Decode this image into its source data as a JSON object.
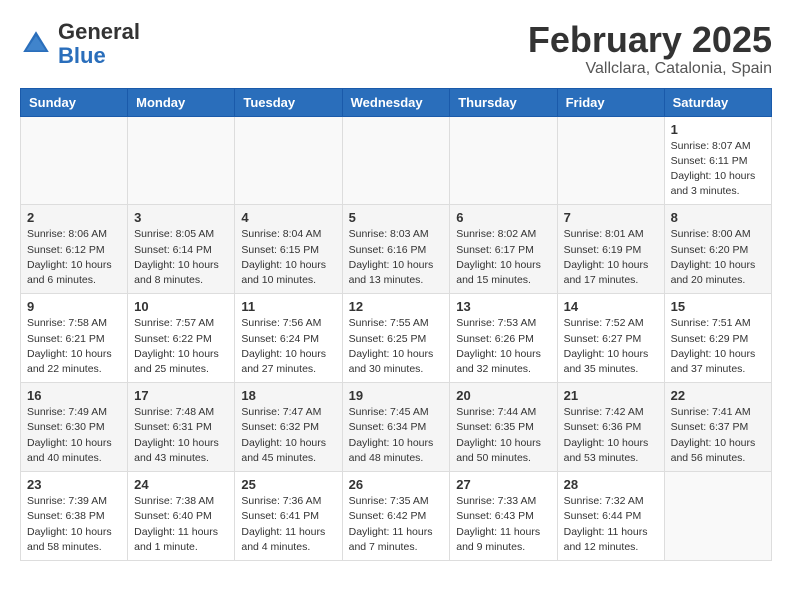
{
  "logo": {
    "general": "General",
    "blue": "Blue"
  },
  "title": "February 2025",
  "location": "Vallclara, Catalonia, Spain",
  "days_of_week": [
    "Sunday",
    "Monday",
    "Tuesday",
    "Wednesday",
    "Thursday",
    "Friday",
    "Saturday"
  ],
  "weeks": [
    [
      {
        "day": "",
        "info": ""
      },
      {
        "day": "",
        "info": ""
      },
      {
        "day": "",
        "info": ""
      },
      {
        "day": "",
        "info": ""
      },
      {
        "day": "",
        "info": ""
      },
      {
        "day": "",
        "info": ""
      },
      {
        "day": "1",
        "info": "Sunrise: 8:07 AM\nSunset: 6:11 PM\nDaylight: 10 hours and 3 minutes."
      }
    ],
    [
      {
        "day": "2",
        "info": "Sunrise: 8:06 AM\nSunset: 6:12 PM\nDaylight: 10 hours and 6 minutes."
      },
      {
        "day": "3",
        "info": "Sunrise: 8:05 AM\nSunset: 6:14 PM\nDaylight: 10 hours and 8 minutes."
      },
      {
        "day": "4",
        "info": "Sunrise: 8:04 AM\nSunset: 6:15 PM\nDaylight: 10 hours and 10 minutes."
      },
      {
        "day": "5",
        "info": "Sunrise: 8:03 AM\nSunset: 6:16 PM\nDaylight: 10 hours and 13 minutes."
      },
      {
        "day": "6",
        "info": "Sunrise: 8:02 AM\nSunset: 6:17 PM\nDaylight: 10 hours and 15 minutes."
      },
      {
        "day": "7",
        "info": "Sunrise: 8:01 AM\nSunset: 6:19 PM\nDaylight: 10 hours and 17 minutes."
      },
      {
        "day": "8",
        "info": "Sunrise: 8:00 AM\nSunset: 6:20 PM\nDaylight: 10 hours and 20 minutes."
      }
    ],
    [
      {
        "day": "9",
        "info": "Sunrise: 7:58 AM\nSunset: 6:21 PM\nDaylight: 10 hours and 22 minutes."
      },
      {
        "day": "10",
        "info": "Sunrise: 7:57 AM\nSunset: 6:22 PM\nDaylight: 10 hours and 25 minutes."
      },
      {
        "day": "11",
        "info": "Sunrise: 7:56 AM\nSunset: 6:24 PM\nDaylight: 10 hours and 27 minutes."
      },
      {
        "day": "12",
        "info": "Sunrise: 7:55 AM\nSunset: 6:25 PM\nDaylight: 10 hours and 30 minutes."
      },
      {
        "day": "13",
        "info": "Sunrise: 7:53 AM\nSunset: 6:26 PM\nDaylight: 10 hours and 32 minutes."
      },
      {
        "day": "14",
        "info": "Sunrise: 7:52 AM\nSunset: 6:27 PM\nDaylight: 10 hours and 35 minutes."
      },
      {
        "day": "15",
        "info": "Sunrise: 7:51 AM\nSunset: 6:29 PM\nDaylight: 10 hours and 37 minutes."
      }
    ],
    [
      {
        "day": "16",
        "info": "Sunrise: 7:49 AM\nSunset: 6:30 PM\nDaylight: 10 hours and 40 minutes."
      },
      {
        "day": "17",
        "info": "Sunrise: 7:48 AM\nSunset: 6:31 PM\nDaylight: 10 hours and 43 minutes."
      },
      {
        "day": "18",
        "info": "Sunrise: 7:47 AM\nSunset: 6:32 PM\nDaylight: 10 hours and 45 minutes."
      },
      {
        "day": "19",
        "info": "Sunrise: 7:45 AM\nSunset: 6:34 PM\nDaylight: 10 hours and 48 minutes."
      },
      {
        "day": "20",
        "info": "Sunrise: 7:44 AM\nSunset: 6:35 PM\nDaylight: 10 hours and 50 minutes."
      },
      {
        "day": "21",
        "info": "Sunrise: 7:42 AM\nSunset: 6:36 PM\nDaylight: 10 hours and 53 minutes."
      },
      {
        "day": "22",
        "info": "Sunrise: 7:41 AM\nSunset: 6:37 PM\nDaylight: 10 hours and 56 minutes."
      }
    ],
    [
      {
        "day": "23",
        "info": "Sunrise: 7:39 AM\nSunset: 6:38 PM\nDaylight: 10 hours and 58 minutes."
      },
      {
        "day": "24",
        "info": "Sunrise: 7:38 AM\nSunset: 6:40 PM\nDaylight: 11 hours and 1 minute."
      },
      {
        "day": "25",
        "info": "Sunrise: 7:36 AM\nSunset: 6:41 PM\nDaylight: 11 hours and 4 minutes."
      },
      {
        "day": "26",
        "info": "Sunrise: 7:35 AM\nSunset: 6:42 PM\nDaylight: 11 hours and 7 minutes."
      },
      {
        "day": "27",
        "info": "Sunrise: 7:33 AM\nSunset: 6:43 PM\nDaylight: 11 hours and 9 minutes."
      },
      {
        "day": "28",
        "info": "Sunrise: 7:32 AM\nSunset: 6:44 PM\nDaylight: 11 hours and 12 minutes."
      },
      {
        "day": "",
        "info": ""
      }
    ]
  ]
}
